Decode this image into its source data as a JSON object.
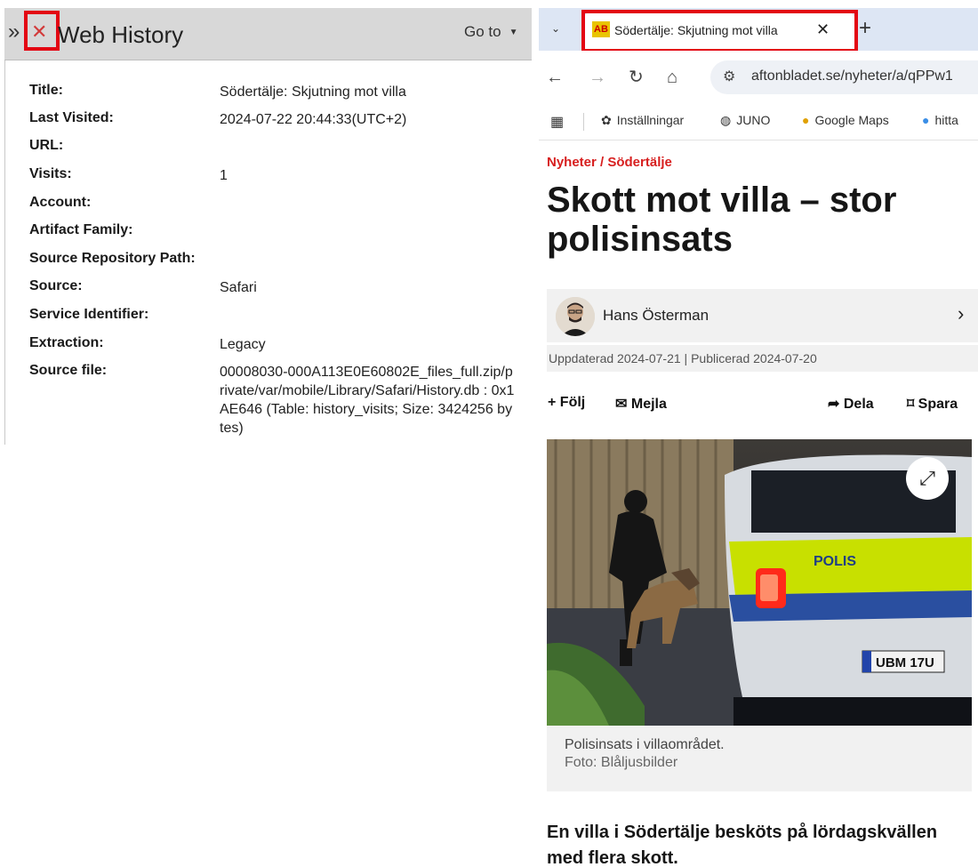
{
  "web_history": {
    "title": "Web History",
    "goto_label": "Go to",
    "fields": [
      {
        "label": "Title:",
        "value": "Södertälje: Skjutning mot villa"
      },
      {
        "label": "Last Visited:",
        "value": "2024-07-22 20:44:33(UTC+2)"
      },
      {
        "label": "URL:",
        "value": ""
      },
      {
        "label": "Visits:",
        "value": "1"
      },
      {
        "label": "Account:",
        "value": ""
      },
      {
        "label": "Artifact Family:",
        "value": ""
      },
      {
        "label": "Source Repository Path:",
        "value": ""
      },
      {
        "label": "Source:",
        "value": "Safari"
      },
      {
        "label": "Service Identifier:",
        "value": ""
      },
      {
        "label": "Extraction:",
        "value": "Legacy"
      },
      {
        "label": "Source file:",
        "value": "00008030-000A113E0E60802E_files_full.zip/private/var/mobile/Library/Safari/History.db : 0x1AE646 (Table: history_visits; Size: 3424256 bytes)"
      }
    ]
  },
  "browser": {
    "tab": {
      "title": "Södertälje: Skjutning mot villa",
      "favicon_text": "AB"
    },
    "url": "aftonbladet.se/nyheter/a/qPPw1",
    "bookmarks": [
      {
        "label": "Inställningar",
        "icon": "gear-icon"
      },
      {
        "label": "JUNO",
        "icon": "globe-icon"
      },
      {
        "label": "Google Maps",
        "icon": "map-pin-icon"
      },
      {
        "label": "hitta",
        "icon": "hitta-icon"
      }
    ]
  },
  "article": {
    "breadcrumb": "Nyheter / Södertälje",
    "headline": "Skott mot villa – stor polisinsats",
    "author": "Hans Österman",
    "dates": "Uppdaterad 2024-07-21 | Publicerad 2024-07-20",
    "actions": {
      "follow": "Följ",
      "mail": "Mejla",
      "share": "Dela",
      "save": "Spara"
    },
    "photo_caption": "Polisinsats i villaområdet.",
    "photo_credit": "Foto: Blåljusbilder",
    "lead": "En villa i Södertälje besköts på lördagskvällen med flera skott.",
    "photo_plate_text": "UBM 17U",
    "photo_car_text": "POLIS"
  },
  "colors": {
    "highlight": "#e30613",
    "accent_red": "#d71f1f"
  }
}
